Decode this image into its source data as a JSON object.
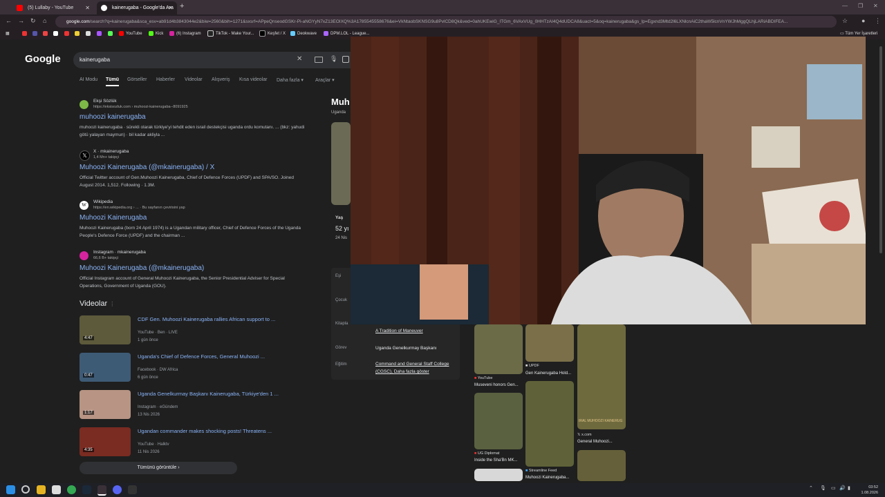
{
  "browser": {
    "tabs": [
      {
        "label": "(5) Lullaby - YouTube",
        "icon": "youtube-icon"
      },
      {
        "label": "kainerugaba - Google'da Ara",
        "icon": "google-icon",
        "active": true
      }
    ],
    "url_host": "google.com",
    "url_path": "/search?q=kainerugaba&sca_esv=ab91d4b3843044e2&biw=2560&bih=1271&sxsrf=APpeQnseodGSKr-Pi-aNGYyN7xZ13EOIXQ%3A1785545558676&ei=VkNtaobSKNSG9u8PvlCD8Qk&ved=0ahUKEwiG_ITGm_6VAxVUg_0HHTzAI4Q4dUDCA8&uact=5&oq=kainerugaba&gs_lp=Egxnd3Mtd2l6LXNlcnAiC2thaW5lcnVnYWJhMggQLhjLARiABDIFEA...",
    "bookmarks": [
      "YouTube",
      "Kick",
      "(6) Instagram",
      "TikTok - Make Your...",
      "Keşfet / X",
      "Deokwave",
      "DPM.LOL - League..."
    ],
    "all_bookmarks": "Tüm Yer İşaretleri"
  },
  "google": {
    "logo": "Google",
    "query": "kainerugaba",
    "tabs": [
      "AI Modu",
      "Tümü",
      "Görseller",
      "Haberler",
      "Videolar",
      "Alışveriş",
      "Kısa videolar",
      "Daha fazla",
      "Araçlar"
    ]
  },
  "results": [
    {
      "site": "Ekşi Sözlük",
      "url": "https://eksisozluk.com › muhoozi-kainerugaba--8091925",
      "title": "muhoozi kainerugaba",
      "snippet": "muhoozi kainerugaba · sürekli olarak türkiye'yi tehdit eden israil destekçisi uganda ordu komutanı. ... (bkz: yahudi götü yalayan maymun) · bil kadar akliyla ...",
      "color": "#7eb847"
    },
    {
      "site": "X · mkainerugaba",
      "url": "1,4 Mn+ takipçi",
      "title": "Muhoozi Kainerugaba (@mkainerugaba) / X",
      "snippet": "Official Twitter account of Gen.Muhoozi Kainerugaba, Chief of Defence Forces (UPDF) and SPA/SO. Joined August 2014. 1,512. Following · 1.3M.",
      "color": "#000000"
    },
    {
      "site": "Wikipedia",
      "url": "https://en.wikipedia.org › ...  · Bu sayfanın çevirisini yap",
      "title": "Muhoozi Kainerugaba",
      "snippet": "Muhoozi Kainerugaba (born 24 April 1974) is a Ugandan military officer, Chief of Defence Forces of the Uganda People's Defence Force (UPDF) and the chairman ...",
      "color": "#ffffff"
    },
    {
      "site": "Instagram · mkainerugaba",
      "url": "66,6 B+ takipçi",
      "title": "Muhoozi Kainerugaba (@mkainerugaba)",
      "snippet": "Official Instagram account of General Muhoozi Kainerugaba, the Senior Presidential Adviser for Special Operations, Government of Uganda (GOU).",
      "color": "#d6249f"
    }
  ],
  "videos_heading": "Videolar",
  "videos": [
    {
      "duration": "4:47",
      "title": "CDF Gen. Muhoozi Kainerugaba rallies African support to ...",
      "meta": "YouTube · Ben · LIVE",
      "date": "1 gün önce",
      "color": "#5d5a3c"
    },
    {
      "duration": "0:47",
      "title": "Uganda's Chief of Defence Forces, General Muhoozi ...",
      "meta": "Facebook · DW Africa",
      "date": "6 gün önce",
      "color": "#3e5b76"
    },
    {
      "duration": "1:17",
      "title": "Uganda Genelkurmay Başkanı Kainerugaba, Türkiye'den 1 ...",
      "meta": "Instagram · eGündem",
      "date": "13 Nis 2026",
      "color": "#b79484"
    },
    {
      "duration": "4:35",
      "title": "Ugandan commander makes shocking posts! Threatens ...",
      "meta": "YouTube · Halktv",
      "date": "11 Nis 2026",
      "color": "#7a2b22"
    }
  ],
  "more_videos": "Tümünü görüntüle",
  "knowledge_panel": {
    "title": "Muh",
    "subtitle": "Uganda",
    "age_label": "Yaş",
    "age_value": "52 yı",
    "age_detail": "24 Nis",
    "rows": [
      {
        "label": "Eşi",
        "value": ""
      },
      {
        "label": "Çocuk",
        "value": ""
      },
      {
        "label": "Kitapla",
        "value": "A Tradition of Maneuver"
      },
      {
        "label": "Görev",
        "value": "Uganda Genelkurmay Başkanı"
      },
      {
        "label": "Eğitim",
        "value": "Command and General Staff College (CGSC), Daha fazla göster"
      }
    ]
  },
  "images": [
    {
      "source": "YouTube",
      "caption": "Museveni honors Gen..."
    },
    {
      "source": "UPDF",
      "caption": "Gen Kainerugaba Hold..."
    },
    {
      "source": "x.com",
      "caption": "General Muhoozi..."
    },
    {
      "source": "UG Diplomat",
      "caption": "Inside the Sha'Bn MK..."
    },
    {
      "source": "Streamline Feed",
      "caption": "Muhoozi Kainerugaba..."
    },
    {
      "overlay": "IRAL MUHOOZI KAINERUG"
    }
  ],
  "taskbar": {
    "time": "03:52",
    "date": "1.08.2026"
  },
  "colors": {
    "link": "#8ab4f8",
    "background": "#1f1f1f",
    "tabstrip": "#3a3038"
  }
}
